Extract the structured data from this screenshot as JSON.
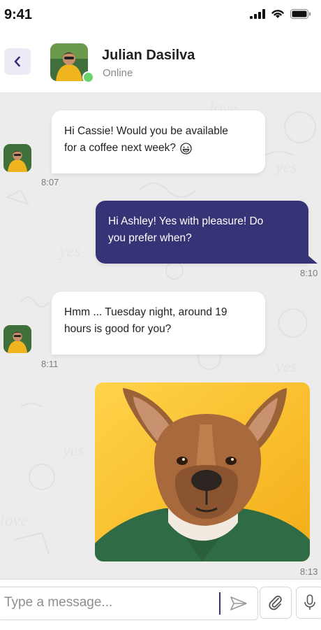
{
  "status_bar": {
    "time": "9:41"
  },
  "header": {
    "contact_name": "Julian Dasilva",
    "contact_status": "Online",
    "accent_color": "#363376",
    "online_color": "#6bd36b"
  },
  "messages": [
    {
      "direction": "incoming",
      "text_line1": "Hi Cassie! Would you be available",
      "text_line2": "for a coffee next week?",
      "emoji": "grinning-face",
      "time": "8:07"
    },
    {
      "direction": "outgoing",
      "text_line1": "Hi Ashley! Yes with pleasure! Do",
      "text_line2": "you prefer when?",
      "time": "8:10"
    },
    {
      "direction": "incoming",
      "text_line1": "Hmm ... Tuesday night, around 19",
      "text_line2": "hours is good for you?",
      "time": "8:11"
    },
    {
      "direction": "outgoing",
      "type": "image",
      "image": "dog-in-green-jacket",
      "time": "8:13"
    }
  ],
  "composer": {
    "placeholder": "Type a message...",
    "send_icon": "send-icon",
    "attach_icon": "paperclip-icon",
    "mic_icon": "microphone-icon"
  }
}
